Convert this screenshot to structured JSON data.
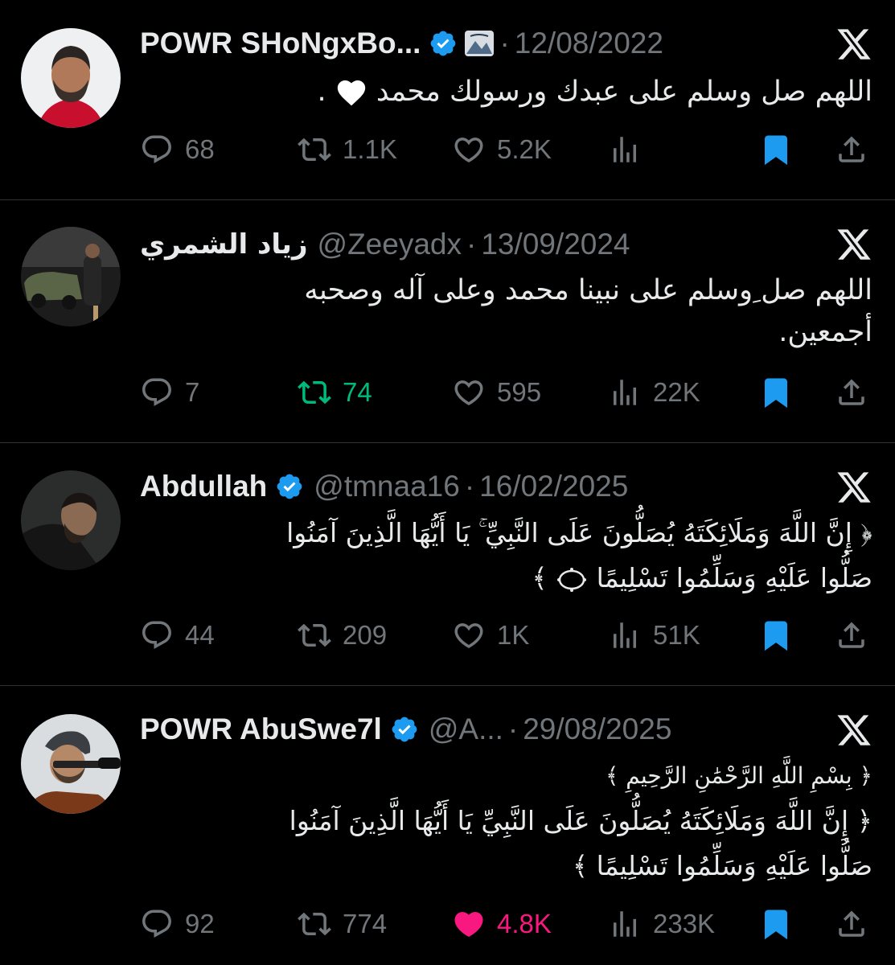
{
  "colors": {
    "background": "#000000",
    "text": "#e7e9ea",
    "muted": "#71767b",
    "verified": "#1d9bf0",
    "bookmark": "#1d9bf0",
    "retweet_active": "#00ba7c",
    "like_active": "#f91880",
    "divider": "#2f3336"
  },
  "tweets": [
    {
      "name": "POWR SHoNgxBo...",
      "verified": true,
      "handle": "",
      "date": "12/08/2022",
      "lines": [
        "اللهم صل وسلم على عبدك ورسولك محمد",
        "."
      ],
      "inline_icon": "white-heart-icon",
      "replies": "68",
      "retweets": "1.1K",
      "likes": "5.2K",
      "views": "",
      "retweeted": false,
      "liked": false,
      "bookmarked": true
    },
    {
      "name": "زياد الشمري",
      "verified": false,
      "handle": "@Zeeyadx",
      "date": "13/09/2024",
      "lines": [
        "اللهم صل ِوسلم على نبينا محمد وعلى آله وصحبه",
        "أجمعين."
      ],
      "replies": "7",
      "retweets": "74",
      "likes": "595",
      "views": "22K",
      "retweeted": true,
      "liked": false,
      "bookmarked": true
    },
    {
      "name": "Abdullah",
      "verified": true,
      "handle": "@tmnaa16",
      "date": "16/02/2025",
      "lines": [
        "﴿ إِنَّ اللَّهَ وَمَلَائِكَتَهُ يُصَلُّونَ عَلَى النَّبِيِّ ۚ يَا أَيُّهَا الَّذِينَ آمَنُوا",
        "صَلُّوا عَلَيْهِ وَسَلِّمُوا تَسْلِيمًا",
        "﴾"
      ],
      "inline_icon": "ayah-end-icon",
      "replies": "44",
      "retweets": "209",
      "likes": "1K",
      "views": "51K",
      "retweeted": false,
      "liked": false,
      "bookmarked": true
    },
    {
      "name": "POWR AbuSwe7l",
      "verified": true,
      "handle": "@A...",
      "date": "29/08/2025",
      "lines": [
        "﴿ بِسْمِ اللَّهِ الرَّحْمَٰنِ الرَّحِيمِ ﴾",
        "﴿ إِنَّ اللَّهَ وَمَلَائِكَتَهُ يُصَلُّونَ عَلَى النَّبِيِّ يَا أَيُّهَا الَّذِينَ آمَنُوا",
        "صَلُّوا عَلَيْهِ وَسَلِّمُوا تَسْلِيمًا ﴾"
      ],
      "replies": "92",
      "retweets": "774",
      "likes": "4.8K",
      "views": "233K",
      "retweeted": false,
      "liked": true,
      "bookmarked": true
    }
  ]
}
